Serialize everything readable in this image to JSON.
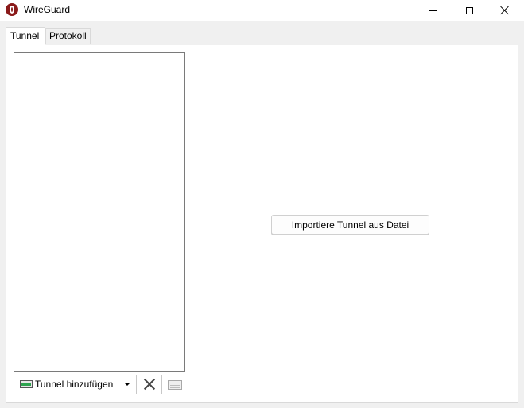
{
  "window": {
    "title": "WireGuard"
  },
  "tabs": [
    {
      "label": "Tunnel",
      "selected": true
    },
    {
      "label": "Protokoll",
      "selected": false
    }
  ],
  "main": {
    "import_button_label": "Importiere Tunnel aus Datei"
  },
  "toolbar": {
    "add_tunnel_label": "Tunnel hinzufügen",
    "icons": [
      "add-tunnel-icon",
      "dropdown-arrow-icon",
      "delete-icon",
      "export-icon"
    ]
  },
  "colors": {
    "app_icon": "#8a1a1a",
    "window_background": "#f0f0f0",
    "panel_background": "#ffffff"
  }
}
